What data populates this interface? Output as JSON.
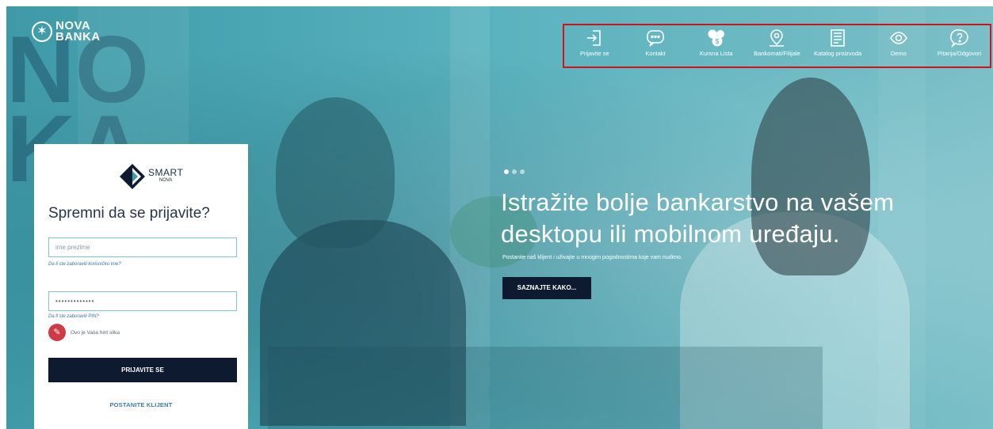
{
  "logo": {
    "line1": "NOVA",
    "line2": "BANKA"
  },
  "topnav": {
    "items": [
      {
        "label": "Prijavite se",
        "icon": "login-icon"
      },
      {
        "label": "Kontakt",
        "icon": "chat-icon"
      },
      {
        "label": "Kursna Lista",
        "icon": "currency-icon"
      },
      {
        "label": "Bankomati/Filijale",
        "icon": "map-pin-icon"
      },
      {
        "label": "Katalog proizvoda",
        "icon": "catalog-icon"
      },
      {
        "label": "Demo",
        "icon": "eye-icon"
      },
      {
        "label": "Pitanja/Odgovori",
        "icon": "question-icon"
      }
    ],
    "highlight_color": "#d0121b"
  },
  "hero": {
    "headline_line1": "Istražite bolje bankarstvo na vašem",
    "headline_line2": "desktopu ili mobilnom uređaju.",
    "subline": "Postanite naš klijent i uživajte u mnogim pogodnostima koje vam nudimo.",
    "cta": "SAZNAJTE KAKO..."
  },
  "login": {
    "brand_smart": "SMART",
    "brand_nova": "NOVA",
    "title": "Spremni da se prijavite?",
    "username_placeholder": "ime.prezime",
    "forgot_username": "Da li ste zaboravili korisničko ime?",
    "password_value": "•••••••••••••",
    "forgot_pin": "Da li ste zaboravili PIN?",
    "hint_text": "Ovo je Vaša hint slika",
    "login_button": "PRIJAVITE SE",
    "register_link": "POSTANITE KLIJENT"
  },
  "colors": {
    "hero_teal": "#4aa6b3",
    "button_navy": "#0e1a30",
    "link_blue": "#3a74a8"
  }
}
